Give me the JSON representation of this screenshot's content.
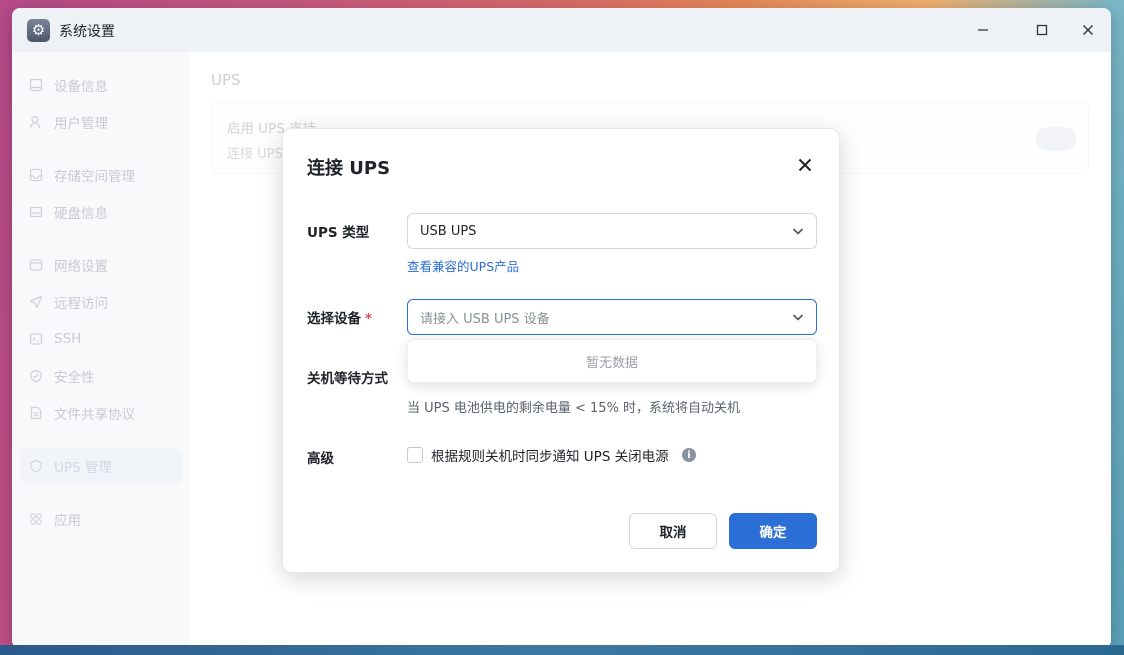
{
  "window": {
    "title": "系统设置"
  },
  "sidebar": {
    "items": [
      {
        "label": "设备信息",
        "icon": "monitor-icon"
      },
      {
        "label": "用户管理",
        "icon": "user-icon"
      },
      {
        "label": "存储空间管理",
        "icon": "storage-icon"
      },
      {
        "label": "硬盘信息",
        "icon": "disk-icon"
      },
      {
        "label": "网络设置",
        "icon": "network-icon"
      },
      {
        "label": "远程访问",
        "icon": "send-icon"
      },
      {
        "label": "SSH",
        "icon": "terminal-icon"
      },
      {
        "label": "安全性",
        "icon": "shield-check-icon"
      },
      {
        "label": "文件共享协议",
        "icon": "file-share-icon"
      },
      {
        "label": "UPS 管理",
        "icon": "shield-icon",
        "active": true
      },
      {
        "label": "应用",
        "icon": "apps-icon"
      }
    ]
  },
  "content": {
    "title": "UPS",
    "card_title": "启用 UPS 支持",
    "card_sub": "连接 UPS"
  },
  "dialog": {
    "title": "连接 UPS",
    "type_label": "UPS 类型",
    "type_value": "USB UPS",
    "compat_prefix": "查看",
    "compat_link": "兼容的UPS产品",
    "device_label": "选择设备",
    "required_mark": "*",
    "device_placeholder": "请接入 USB UPS 设备",
    "dropdown_empty": "暂无数据",
    "shutdown_label": "关机等待方式",
    "shutdown_hint": "当 UPS 电池供电的剩余电量 < 15% 时，系统将自动关机",
    "advanced_label": "高级",
    "advanced_checkbox": "根据规则关机时同步通知 UPS 关闭电源",
    "cancel": "取消",
    "ok": "确定"
  }
}
